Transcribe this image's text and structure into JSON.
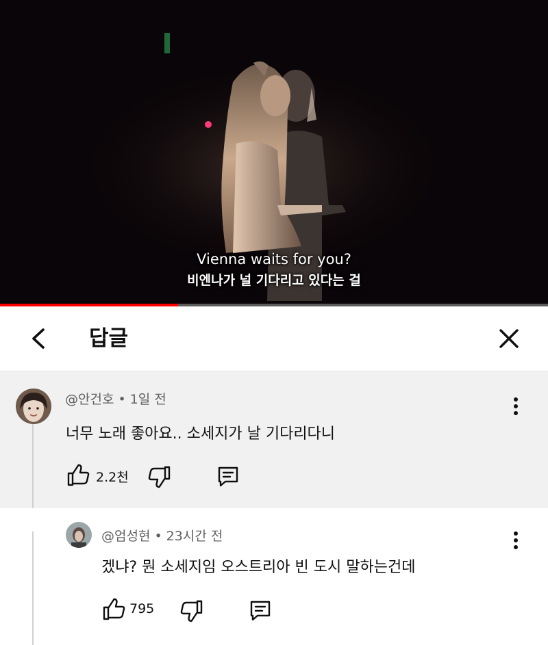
{
  "video": {
    "subtitle_en": "Vienna waits for you?",
    "subtitle_ko": "비엔나가 널 기다리고 있다는 걸",
    "progress": 0.325,
    "progress_color": "#ff0000"
  },
  "header": {
    "title": "답글",
    "back_icon": "chevron-left-icon",
    "close_icon": "close-icon"
  },
  "comments": [
    {
      "author": "@안건호",
      "separator": "•",
      "time": "1일 전",
      "text": "너무 노래 좋아요.. 소세지가 날 기다리다니",
      "likes": "2.2천",
      "background": "#f1f1f1"
    },
    {
      "author": "@엄성현",
      "separator": "•",
      "time": "23시간 전",
      "text": "겠냐? 뭔 소세지임 오스트리아 빈 도시 말하는건데",
      "likes": "795",
      "background": "#ffffff"
    }
  ],
  "icons": {
    "like": "thumbs-up-icon",
    "dislike": "thumbs-down-icon",
    "reply": "reply-icon",
    "more": "more-vertical-icon"
  }
}
